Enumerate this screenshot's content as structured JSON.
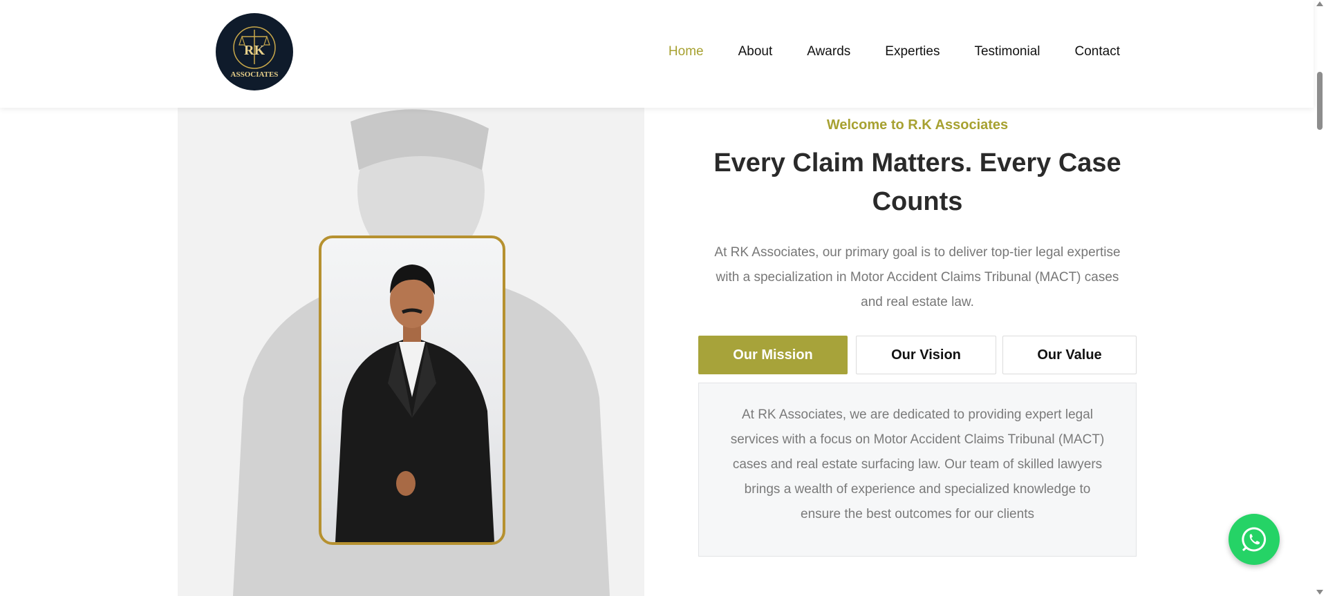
{
  "brand": {
    "logo_initials": "RK",
    "logo_text": "ASSOCIATES"
  },
  "nav": {
    "items": [
      {
        "label": "Home",
        "active": true
      },
      {
        "label": "About",
        "active": false
      },
      {
        "label": "Awards",
        "active": false
      },
      {
        "label": "Experties",
        "active": false
      },
      {
        "label": "Testimonial",
        "active": false
      },
      {
        "label": "Contact",
        "active": false
      }
    ]
  },
  "hero": {
    "welcome": "Welcome to R.K Associates",
    "headline_line1": "Every Claim Matters. Every Case",
    "headline_line2": "Counts",
    "intro_line1": "At RK Associates, our primary goal is to deliver top-tier legal expertise",
    "intro_line2": "with a specialization in Motor Accident Claims Tribunal (MACT) cases",
    "intro_line3": "and real estate law."
  },
  "tabs": {
    "items": [
      {
        "label": "Our Mission",
        "active": true
      },
      {
        "label": "Our Vision",
        "active": false
      },
      {
        "label": "Our Value",
        "active": false
      }
    ],
    "panel_lines": [
      "At RK Associates, we are dedicated to providing expert legal",
      "services with a focus on Motor Accident Claims Tribunal (MACT)",
      "cases and real estate surfacing law. Our team of skilled lawyers",
      "brings a wealth of experience and specialized knowledge to",
      "ensure the best outcomes for our clients"
    ]
  },
  "colors": {
    "accent": "#a7a131",
    "tab_active": "#a7a33a",
    "portrait_border": "#b69130",
    "whatsapp": "#25d366",
    "logo_bg": "#0f1b2b"
  },
  "icons": {
    "logo": "scales-of-justice-icon",
    "whatsapp": "whatsapp-icon"
  }
}
